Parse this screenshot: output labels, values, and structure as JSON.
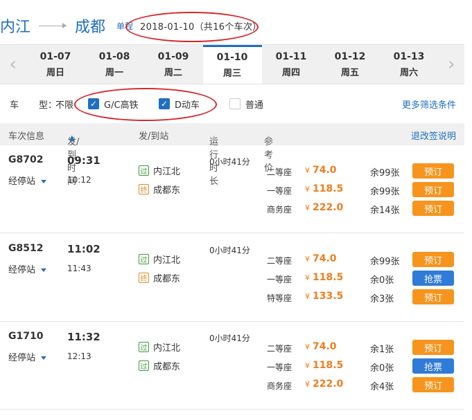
{
  "header": {
    "from": "内江",
    "to": "成都",
    "trip_type": "单程",
    "date_summary": "2018-01-10（共16个车次）"
  },
  "datebar": {
    "days": [
      {
        "date": "01-07",
        "weekday": "周日"
      },
      {
        "date": "01-08",
        "weekday": "周一"
      },
      {
        "date": "01-09",
        "weekday": "周二"
      },
      {
        "date": "01-10",
        "weekday": "周三",
        "active": true
      },
      {
        "date": "01-11",
        "weekday": "周四"
      },
      {
        "date": "01-12",
        "weekday": "周五"
      },
      {
        "date": "01-13",
        "weekday": "周六"
      }
    ]
  },
  "filter": {
    "label_part1": "车",
    "label_part2": "型：",
    "unlimited": "不限",
    "options": [
      {
        "label": "G/C高铁",
        "checked": true
      },
      {
        "label": "D动车",
        "checked": true
      },
      {
        "label": "普通",
        "checked": false
      }
    ],
    "more": "更多筛选条件"
  },
  "table_header": {
    "train_info": "车次信息",
    "dep_arr_time": "发/到时间",
    "dep_arr_station": "发/到站",
    "duration": "运行时长",
    "ref_price": "参考价",
    "refund_note": "退改签说明"
  },
  "trains": [
    {
      "no": "G8702",
      "stops": "经停站",
      "dep": "09:31",
      "arr": "10:12",
      "from_tag": "过",
      "from": "内江北",
      "to_tag": "终",
      "to": "成都东",
      "duration": "0小时41分",
      "seats": [
        {
          "class": "二等座",
          "currency": "¥",
          "price": "74.0",
          "remain": "余99张",
          "action": "预订",
          "type": "book"
        },
        {
          "class": "一等座",
          "currency": "¥",
          "price": "118.5",
          "remain": "余99张",
          "action": "预订",
          "type": "book"
        },
        {
          "class": "商务座",
          "currency": "¥",
          "price": "222.0",
          "remain": "余14张",
          "action": "预订",
          "type": "book"
        }
      ]
    },
    {
      "no": "G8512",
      "stops": "经停站",
      "dep": "11:02",
      "arr": "11:43",
      "from_tag": "过",
      "from": "内江北",
      "to_tag": "终",
      "to": "成都东",
      "duration": "0小时41分",
      "seats": [
        {
          "class": "二等座",
          "currency": "¥",
          "price": "74.0",
          "remain": "余99张",
          "action": "预订",
          "type": "book"
        },
        {
          "class": "一等座",
          "currency": "¥",
          "price": "118.5",
          "remain": "余0张",
          "action": "抢票",
          "type": "grab"
        },
        {
          "class": "特等座",
          "currency": "¥",
          "price": "133.5",
          "remain": "余3张",
          "action": "预订",
          "type": "book"
        }
      ]
    },
    {
      "no": "G1710",
      "stops": "经停站",
      "dep": "11:32",
      "arr": "12:13",
      "from_tag": "过",
      "from": "内江北",
      "to_tag": "过",
      "to": "成都东",
      "duration": "0小时41分",
      "seats": [
        {
          "class": "二等座",
          "currency": "¥",
          "price": "74.0",
          "remain": "余1张",
          "action": "预订",
          "type": "book"
        },
        {
          "class": "一等座",
          "currency": "¥",
          "price": "118.5",
          "remain": "余0张",
          "action": "抢票",
          "type": "grab"
        },
        {
          "class": "商务座",
          "currency": "¥",
          "price": "222.0",
          "remain": "余4张",
          "action": "预订",
          "type": "book"
        }
      ]
    }
  ]
}
